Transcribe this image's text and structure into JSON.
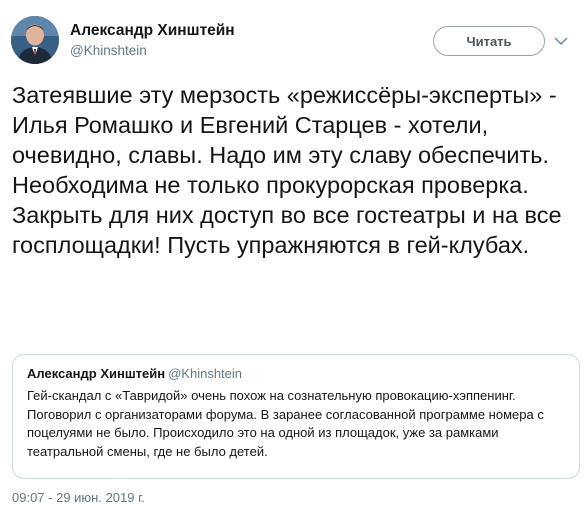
{
  "author": {
    "name": "Александр Хинштейн",
    "handle": "@Khinshtein"
  },
  "follow_label": "Читать",
  "tweet_text": "Затеявшие эту мерзость «режиссёры-эксперты» - Илья Ромашко и Евгений Старцев - хотели, очевидно, славы. Надо им эту славу обеспечить. Необходима не только прокурорская проверка. Закрыть для них доступ во все госте­атры и на все госплощадки! Пусть упражняются в гей-клубах.",
  "quoted": {
    "name": "Александр Хинштейн",
    "handle": "@Khinshtein",
    "text": "Гей-скандал с «Тавридой» очень похож на сознательную провокацию-хэппенинг. Поговорил с организаторами форума. В заранее согласованной программе номера с поцелуями не было. Происходило это на одной из площадок, уже за рамками театральной смены, где не было детей."
  },
  "timestamp": "09:07 - 29 июн. 2019 г.",
  "icons": {
    "avatar": "avatar-photo",
    "menu": "chevron-down-icon"
  },
  "colors": {
    "text": "#14171a",
    "secondary": "#657786",
    "border": "#ccd6dd"
  }
}
